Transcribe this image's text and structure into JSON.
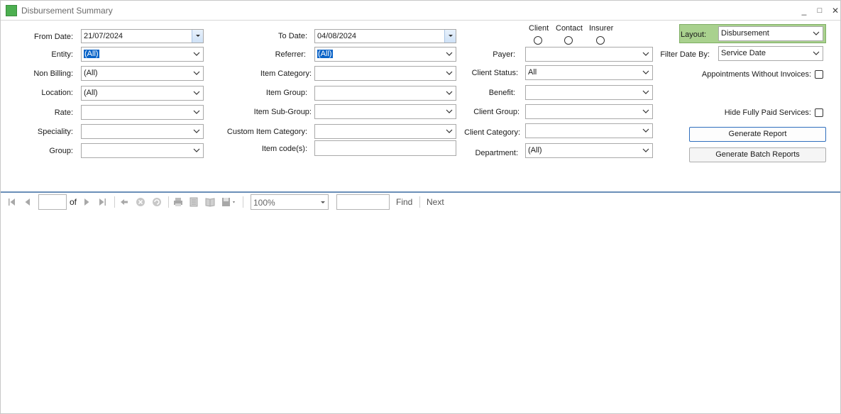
{
  "window": {
    "title": "Disbursement Summary",
    "controls": {
      "minimize": "_",
      "maximize": "□",
      "close": "✕"
    },
    "accent_color": "#4caf50"
  },
  "filters": {
    "from_date": {
      "label": "From Date:",
      "value": "21/07/2024"
    },
    "to_date": {
      "label": "To Date:",
      "value": "04/08/2024"
    },
    "entity": {
      "label": "Entity:",
      "value": "(All)"
    },
    "referrer": {
      "label": "Referrer:",
      "value": "(All)"
    },
    "payer": {
      "label": "Payer:",
      "value": ""
    },
    "filter_date_by": {
      "label": "Filter Date By:",
      "value": "Service Date"
    },
    "non_billing": {
      "label": "Non Billing:",
      "value": "(All)"
    },
    "item_category": {
      "label": "Item Category:",
      "value": ""
    },
    "client_status": {
      "label": "Client Status:",
      "value": "All"
    },
    "location": {
      "label": "Location:",
      "value": "(All)"
    },
    "item_group": {
      "label": "Item Group:",
      "value": ""
    },
    "benefit": {
      "label": "Benefit:",
      "value": ""
    },
    "rate": {
      "label": "Rate:",
      "value": ""
    },
    "item_sub_group": {
      "label": "Item Sub-Group:",
      "value": ""
    },
    "client_group": {
      "label": "Client Group:",
      "value": ""
    },
    "speciality": {
      "label": "Speciality:",
      "value": ""
    },
    "custom_item_category": {
      "label": "Custom Item Category:",
      "value": ""
    },
    "client_category": {
      "label": "Client Category:",
      "value": ""
    },
    "group": {
      "label": "Group:",
      "value": ""
    },
    "item_codes": {
      "label": "Item code(s):",
      "value": ""
    },
    "department": {
      "label": "Department:",
      "value": "(All)"
    }
  },
  "payer_type": {
    "options": [
      "Client",
      "Contact",
      "Insurer"
    ]
  },
  "layout": {
    "label": "Layout:",
    "value": "Disbursement",
    "highlight_color": "#a9d18e"
  },
  "options": {
    "appointments_without_invoices": {
      "label": "Appointments Without Invoices:",
      "checked": false
    },
    "hide_fully_paid_services": {
      "label": "Hide Fully Paid Services:",
      "checked": false
    }
  },
  "actions": {
    "generate_report": "Generate Report",
    "generate_batch_reports": "Generate Batch Reports"
  },
  "viewer_toolbar": {
    "page_input": "",
    "of_label": "of",
    "zoom": "100%",
    "search_input": "",
    "find_label": "Find",
    "next_label": "Next"
  }
}
